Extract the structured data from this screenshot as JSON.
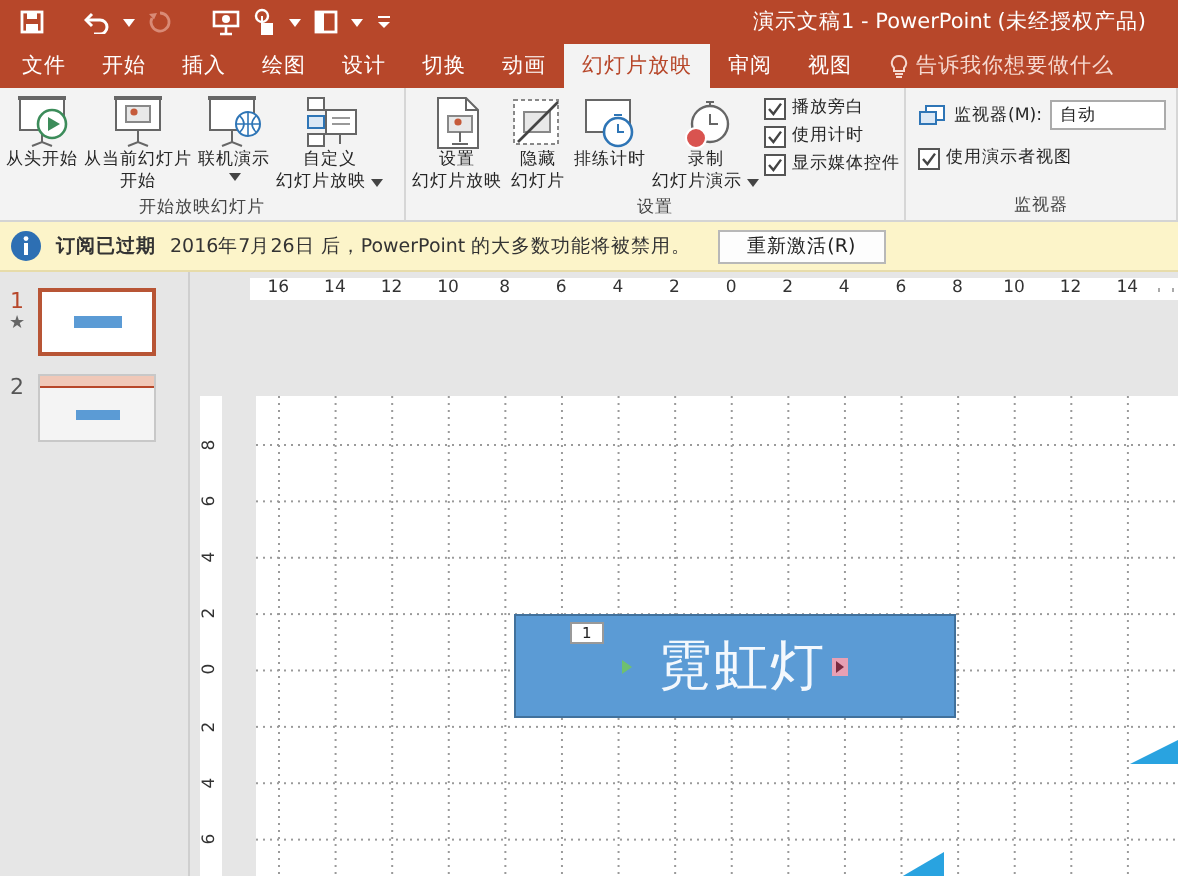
{
  "window": {
    "title": "演示文稿1 - PowerPoint (未经授权产品)"
  },
  "tabs": [
    {
      "label": "文件",
      "selected": false
    },
    {
      "label": "开始",
      "selected": false
    },
    {
      "label": "插入",
      "selected": false
    },
    {
      "label": "绘图",
      "selected": false
    },
    {
      "label": "设计",
      "selected": false
    },
    {
      "label": "切换",
      "selected": false
    },
    {
      "label": "动画",
      "selected": false
    },
    {
      "label": "幻灯片放映",
      "selected": true
    },
    {
      "label": "审阅",
      "selected": false
    },
    {
      "label": "视图",
      "selected": false
    }
  ],
  "tell_me": {
    "placeholder": "告诉我你想要做什么"
  },
  "ribbon": {
    "groups": [
      {
        "label": "开始放映幻灯片",
        "items": [
          {
            "kind": "large",
            "lines": [
              "从头开始"
            ],
            "menu": false
          },
          {
            "kind": "large",
            "lines": [
              "从当前幻灯片",
              "开始"
            ],
            "menu": false
          },
          {
            "kind": "large",
            "lines": [
              "联机演示"
            ],
            "menu": true
          },
          {
            "kind": "large",
            "lines": [
              "自定义",
              "幻灯片放映"
            ],
            "menu": true
          }
        ]
      },
      {
        "label": "设置",
        "items": [
          {
            "kind": "large",
            "lines": [
              "设置",
              "幻灯片放映"
            ],
            "menu": false
          },
          {
            "kind": "large",
            "lines": [
              "隐藏",
              "幻灯片"
            ],
            "menu": false
          },
          {
            "kind": "large",
            "lines": [
              "排练计时"
            ],
            "menu": false
          },
          {
            "kind": "large",
            "lines": [
              "录制",
              "幻灯片演示"
            ],
            "menu": true
          },
          {
            "kind": "checks",
            "items": [
              {
                "label": "播放旁白",
                "checked": true
              },
              {
                "label": "使用计时",
                "checked": true
              },
              {
                "label": "显示媒体控件",
                "checked": true
              }
            ]
          }
        ]
      },
      {
        "label": "监视器",
        "items": [
          {
            "kind": "select",
            "label": "监视器(M):",
            "value": "自动"
          },
          {
            "kind": "checks",
            "items": [
              {
                "label": "使用演示者视图",
                "checked": true
              }
            ]
          }
        ]
      }
    ]
  },
  "message_bar": {
    "title": "订阅已过期",
    "text": "2016年7月26日 后，PowerPoint 的大多数功能将被禁用。",
    "button": "重新激活(R)"
  },
  "slides": [
    {
      "number": "1",
      "selected": true,
      "kind": "shape",
      "animation_mark": "★"
    },
    {
      "number": "2",
      "selected": false,
      "kind": "screenshot"
    }
  ],
  "ruler": {
    "horizontal": [
      "16",
      "14",
      "12",
      "10",
      "8",
      "6",
      "4",
      "2",
      "0",
      "2",
      "4",
      "6",
      "8",
      "10",
      "12",
      "14"
    ],
    "vertical": [
      "8",
      "6",
      "4",
      "2",
      "0",
      "2",
      "4",
      "6"
    ]
  },
  "slide": {
    "shape": {
      "text": "霓虹灯",
      "tag": "1"
    }
  }
}
